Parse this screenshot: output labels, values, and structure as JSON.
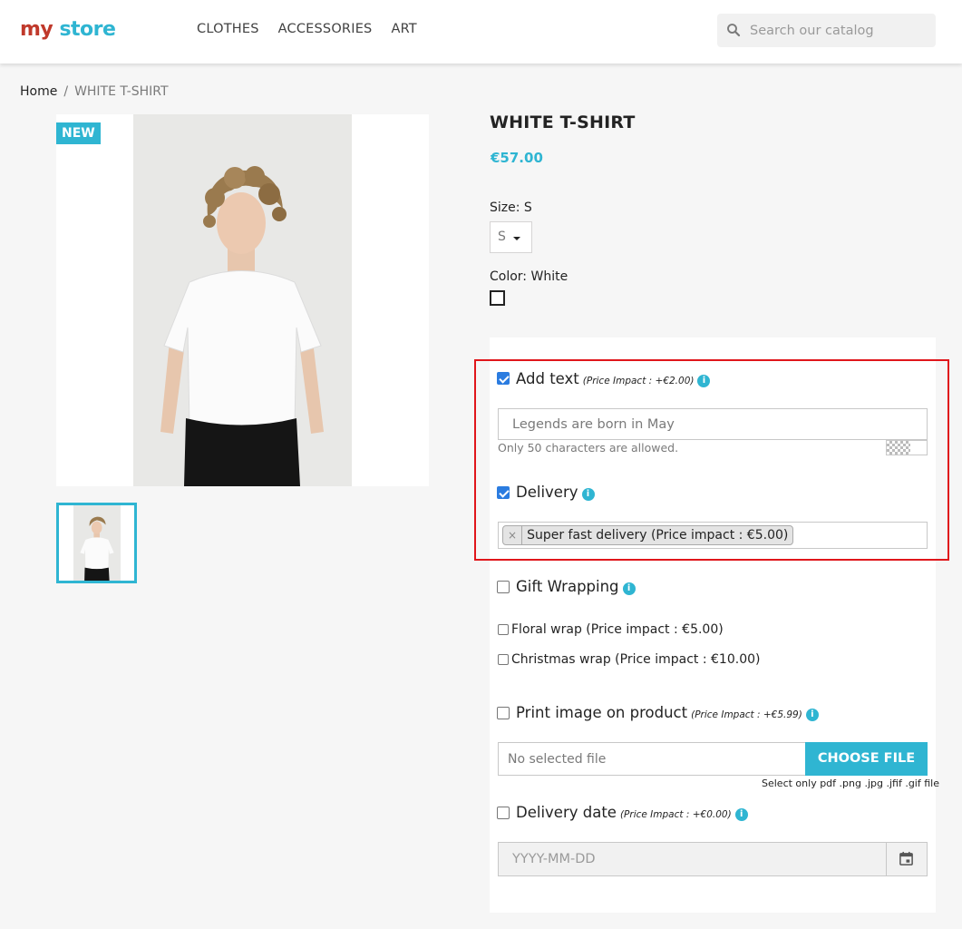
{
  "header": {
    "logo": {
      "word1": "my",
      "word2": "store"
    },
    "nav": [
      "CLOTHES",
      "ACCESSORIES",
      "ART"
    ],
    "search_placeholder": "Search our catalog"
  },
  "breadcrumb": {
    "home": "Home",
    "separator": "/",
    "current": "WHITE T-SHIRT"
  },
  "product": {
    "badge": "NEW",
    "title": "WHITE T-SHIRT",
    "price": "€57.00",
    "size_label": "Size: S",
    "size_value": "S",
    "color_label": "Color: White"
  },
  "customization": {
    "add_text": {
      "checked": true,
      "label": "Add text",
      "impact": "(Price Impact : +€2.00)",
      "value": "Legends are born in May",
      "hint": "Only 50 characters are allowed."
    },
    "delivery": {
      "checked": true,
      "label": "Delivery",
      "tag_remove": "×",
      "selected": "Super fast delivery (Price impact : €5.00)"
    },
    "gift_wrapping": {
      "checked": false,
      "label": "Gift Wrapping",
      "options": [
        "Floral wrap (Price impact : €5.00)",
        "Christmas wrap (Price impact : €10.00)"
      ]
    },
    "print_image": {
      "checked": false,
      "label": "Print image on product",
      "impact": "(Price Impact : +€5.99)",
      "file_placeholder": "No selected file",
      "button": "CHOOSE FILE",
      "hint": "Select only pdf .png .jpg .jfif .gif file"
    },
    "delivery_date": {
      "checked": false,
      "label": "Delivery date",
      "impact": "(Price Impact : +€0.00)",
      "placeholder": "YYYY-MM-DD"
    }
  },
  "icons": {
    "info": "i"
  },
  "colors": {
    "accent": "#2fb5d2",
    "highlight": "#e0161b",
    "checkbox": "#2b7ce0"
  }
}
